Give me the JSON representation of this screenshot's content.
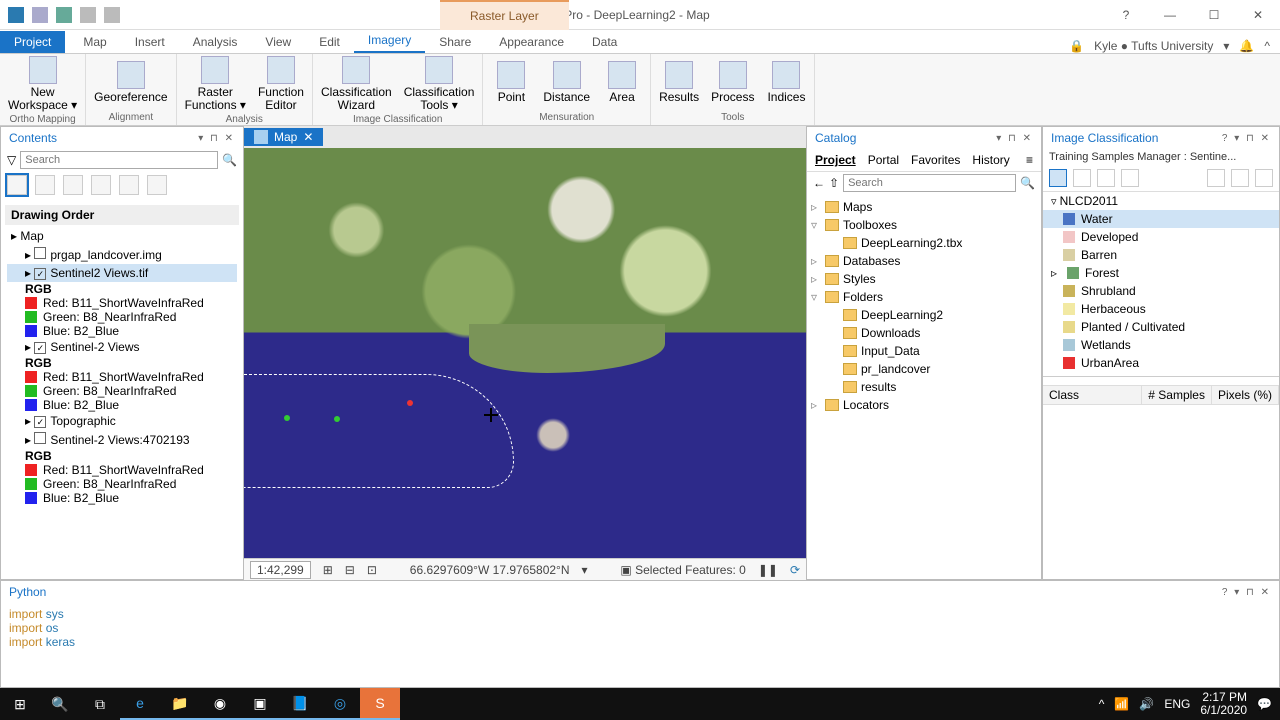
{
  "title": "ArcGIS Pro - DeepLearning2 - Map",
  "context_tab": "Raster Layer",
  "win": {
    "help": "?",
    "min": "—",
    "max": "☐",
    "close": "✕"
  },
  "user": {
    "name": "Kyle ● Tufts University",
    "dd": "▾",
    "bell": "🔔"
  },
  "tabs": [
    "Project",
    "Map",
    "Insert",
    "Analysis",
    "View",
    "Edit",
    "Imagery",
    "Share",
    "Appearance",
    "Data"
  ],
  "active_tab": "Imagery",
  "ribbon_groups": [
    {
      "label": "Ortho Mapping",
      "items": [
        {
          "label": "New\nWorkspace ▾"
        }
      ]
    },
    {
      "label": "Alignment",
      "items": [
        {
          "label": "Georeference"
        }
      ]
    },
    {
      "label": "Analysis",
      "items": [
        {
          "label": "Raster\nFunctions ▾"
        },
        {
          "label": "Function\nEditor"
        }
      ]
    },
    {
      "label": "Image Classification",
      "items": [
        {
          "label": "Classification\nWizard"
        },
        {
          "label": "Classification\nTools ▾"
        }
      ]
    },
    {
      "label": "Mensuration",
      "items": [
        {
          "label": "Point"
        },
        {
          "label": "Distance"
        },
        {
          "label": "Area"
        }
      ]
    },
    {
      "label": "Tools",
      "items": [
        {
          "label": "Results"
        },
        {
          "label": "Process"
        },
        {
          "label": "Indices"
        }
      ]
    }
  ],
  "contents": {
    "title": "Contents",
    "search_placeholder": "Search",
    "drawing_order": "Drawing Order",
    "nodes": [
      {
        "label": "Map",
        "chk": false,
        "lvl": 0
      },
      {
        "label": "prgap_landcover.img",
        "chk": false,
        "lvl": 1,
        "box": true
      },
      {
        "label": "Sentinel2 Views.tif",
        "chk": true,
        "lvl": 1,
        "sel": true,
        "box": true
      },
      {
        "rgb": true
      },
      {
        "band": "Red:",
        "val": "B11_ShortWaveInfraRed",
        "color": "#e22"
      },
      {
        "band": "Green:",
        "val": "B8_NearInfraRed",
        "color": "#2b2"
      },
      {
        "band": "Blue:",
        "val": "B2_Blue",
        "color": "#22e"
      },
      {
        "label": "Sentinel-2 Views",
        "chk": true,
        "lvl": 1,
        "box": true
      },
      {
        "rgb": true
      },
      {
        "band": "Red:",
        "val": "B11_ShortWaveInfraRed",
        "color": "#e22"
      },
      {
        "band": "Green:",
        "val": "B8_NearInfraRed",
        "color": "#2b2"
      },
      {
        "band": "Blue:",
        "val": "B2_Blue",
        "color": "#22e"
      },
      {
        "label": "Topographic",
        "chk": true,
        "lvl": 1,
        "box": true
      },
      {
        "label": "Sentinel-2 Views:4702193",
        "chk": false,
        "lvl": 1,
        "box": true
      },
      {
        "rgb": true
      },
      {
        "band": "Red:",
        "val": "B11_ShortWaveInfraRed",
        "color": "#e22"
      },
      {
        "band": "Green:",
        "val": "B8_NearInfraRed",
        "color": "#2b2"
      },
      {
        "band": "Blue:",
        "val": "B2_Blue",
        "color": "#22e"
      }
    ]
  },
  "map_tab": "Map",
  "status": {
    "scale": "1:42,299",
    "coords": "66.6297609°W 17.9765802°N",
    "selected": "Selected Features: 0"
  },
  "catalog": {
    "title": "Catalog",
    "tabs": [
      "Project",
      "Portal",
      "Favorites",
      "History"
    ],
    "search_placeholder": "Search",
    "nodes": [
      {
        "label": "Maps",
        "lvl": 1,
        "exp": "▹"
      },
      {
        "label": "Toolboxes",
        "lvl": 1,
        "exp": "▿"
      },
      {
        "label": "DeepLearning2.tbx",
        "lvl": 2,
        "ico": "tbx"
      },
      {
        "label": "Databases",
        "lvl": 1,
        "exp": "▹"
      },
      {
        "label": "Styles",
        "lvl": 1,
        "exp": "▹"
      },
      {
        "label": "Folders",
        "lvl": 1,
        "exp": "▿"
      },
      {
        "label": "DeepLearning2",
        "lvl": 2
      },
      {
        "label": "Downloads",
        "lvl": 2
      },
      {
        "label": "Input_Data",
        "lvl": 2
      },
      {
        "label": "pr_landcover",
        "lvl": 2
      },
      {
        "label": "results",
        "lvl": 2
      },
      {
        "label": "Locators",
        "lvl": 1,
        "exp": "▹"
      }
    ]
  },
  "ic": {
    "title": "Image Classification",
    "subtitle": "Training Samples Manager : Sentine...",
    "root": "NLCD2011",
    "classes": [
      {
        "name": "Water",
        "color": "#4a74c4",
        "sel": true
      },
      {
        "name": "Developed",
        "color": "#f2c6c6"
      },
      {
        "name": "Barren",
        "color": "#d9cfa3"
      },
      {
        "name": "Forest",
        "color": "#6aa36a",
        "exp": "▹"
      },
      {
        "name": "Shrubland",
        "color": "#c9b35a"
      },
      {
        "name": "Herbaceous",
        "color": "#f2e9a3"
      },
      {
        "name": "Planted / Cultivated",
        "color": "#e8d98a"
      },
      {
        "name": "Wetlands",
        "color": "#a8c8d8"
      },
      {
        "name": "UrbanArea",
        "color": "#e83030"
      }
    ],
    "cols": [
      "Class",
      "# Samples",
      "Pixels (%)"
    ]
  },
  "python": {
    "title": "Python",
    "lines": [
      {
        "kw": "import",
        "mod": "sys"
      },
      {
        "kw": "import",
        "mod": "os"
      },
      {
        "kw": "import",
        "mod": "keras"
      }
    ]
  },
  "tray": {
    "lang": "ENG",
    "time": "2:17 PM",
    "date": "6/1/2020"
  }
}
